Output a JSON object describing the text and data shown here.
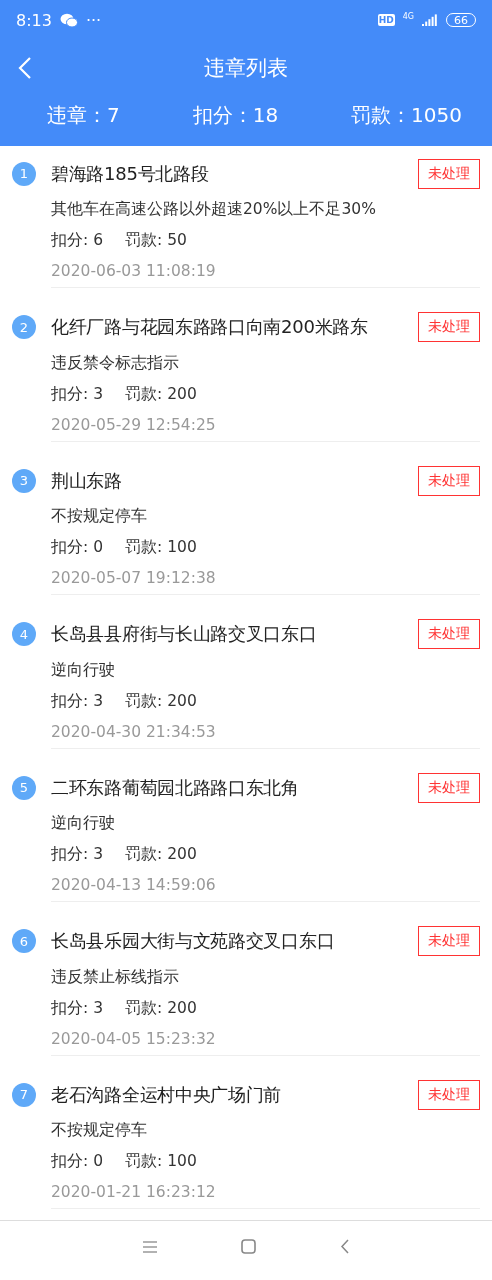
{
  "status_bar": {
    "time": "8:13",
    "more": "···",
    "hd": "HD",
    "network": "4G",
    "battery": "66"
  },
  "header": {
    "title": "违章列表"
  },
  "summary": [
    {
      "label": "违章：",
      "value": "7"
    },
    {
      "label": "扣分：",
      "value": "18"
    },
    {
      "label": "罚款：",
      "value": "1050"
    }
  ],
  "violations": [
    {
      "index": "1",
      "location": "碧海路185号北路段",
      "description": "其他车在高速公路以外超速20%以上不足30%",
      "points": "扣分: 6",
      "fine": "罚款: 50",
      "time": "2020-06-03 11:08:19",
      "status": "未处理"
    },
    {
      "index": "2",
      "location": "化纤厂路与花园东路路口向南200米路东",
      "description": "违反禁令标志指示",
      "points": "扣分: 3",
      "fine": "罚款: 200",
      "time": "2020-05-29 12:54:25",
      "status": "未处理"
    },
    {
      "index": "3",
      "location": "荆山东路",
      "description": "不按规定停车",
      "points": "扣分: 0",
      "fine": "罚款: 100",
      "time": "2020-05-07 19:12:38",
      "status": "未处理"
    },
    {
      "index": "4",
      "location": "长岛县县府街与长山路交叉口东口",
      "description": "逆向行驶",
      "points": "扣分: 3",
      "fine": "罚款: 200",
      "time": "2020-04-30 21:34:53",
      "status": "未处理"
    },
    {
      "index": "5",
      "location": "二环东路葡萄园北路路口东北角",
      "description": "逆向行驶",
      "points": "扣分: 3",
      "fine": "罚款: 200",
      "time": "2020-04-13 14:59:06",
      "status": "未处理"
    },
    {
      "index": "6",
      "location": "长岛县乐园大街与文苑路交叉口东口",
      "description": "违反禁止标线指示",
      "points": "扣分: 3",
      "fine": "罚款: 200",
      "time": "2020-04-05 15:23:32",
      "status": "未处理"
    },
    {
      "index": "7",
      "location": "老石沟路全运村中央广场门前",
      "description": "不按规定停车",
      "points": "扣分: 0",
      "fine": "罚款: 100",
      "time": "2020-01-21 16:23:12",
      "status": "未处理"
    }
  ]
}
